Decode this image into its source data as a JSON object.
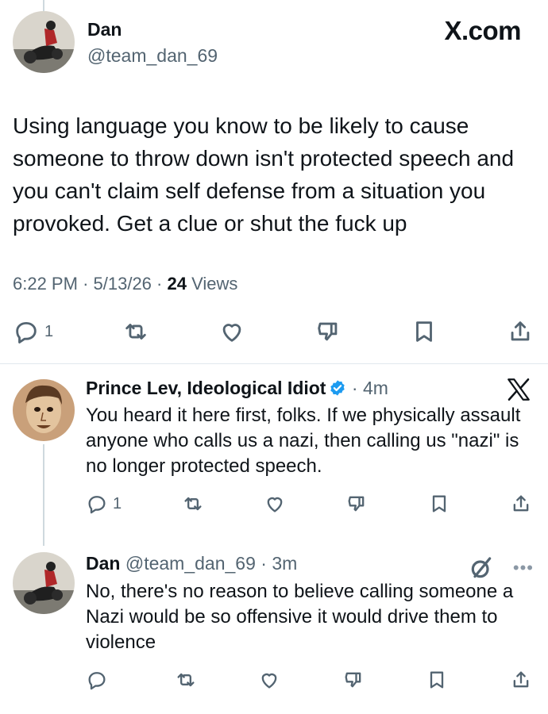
{
  "main_tweet": {
    "author_name": "Dan",
    "handle": "@team_dan_69",
    "site_label": "X.com",
    "text": "Using language you know to be likely to cause someone to throw down isn't protected speech and you can't claim self defense from a situation you provoked. Get a clue or shut the fuck up",
    "time": "6:22 PM",
    "date": "5/13/26",
    "views_count": "24",
    "views_label": "Views",
    "reply_count": "1"
  },
  "replies": [
    {
      "author_name": "Prince Lev, Ideological Idiot",
      "verified": true,
      "age": "4m",
      "text": "You heard it here first, folks. If we physically assault anyone who calls us a nazi, then calling us \"nazi\" is no longer protected speech.",
      "reply_count": "1"
    },
    {
      "author_name": "Dan",
      "handle": "@team_dan_69",
      "age": "3m",
      "text": "No, there's no reason to believe calling someone a Nazi would be so offensive it would drive them to violence",
      "reply_count": ""
    }
  ],
  "colors": {
    "text": "#0f1419",
    "secondary": "#536471",
    "verified_blue": "#1d9bf0",
    "divider": "#e1e8ed"
  }
}
